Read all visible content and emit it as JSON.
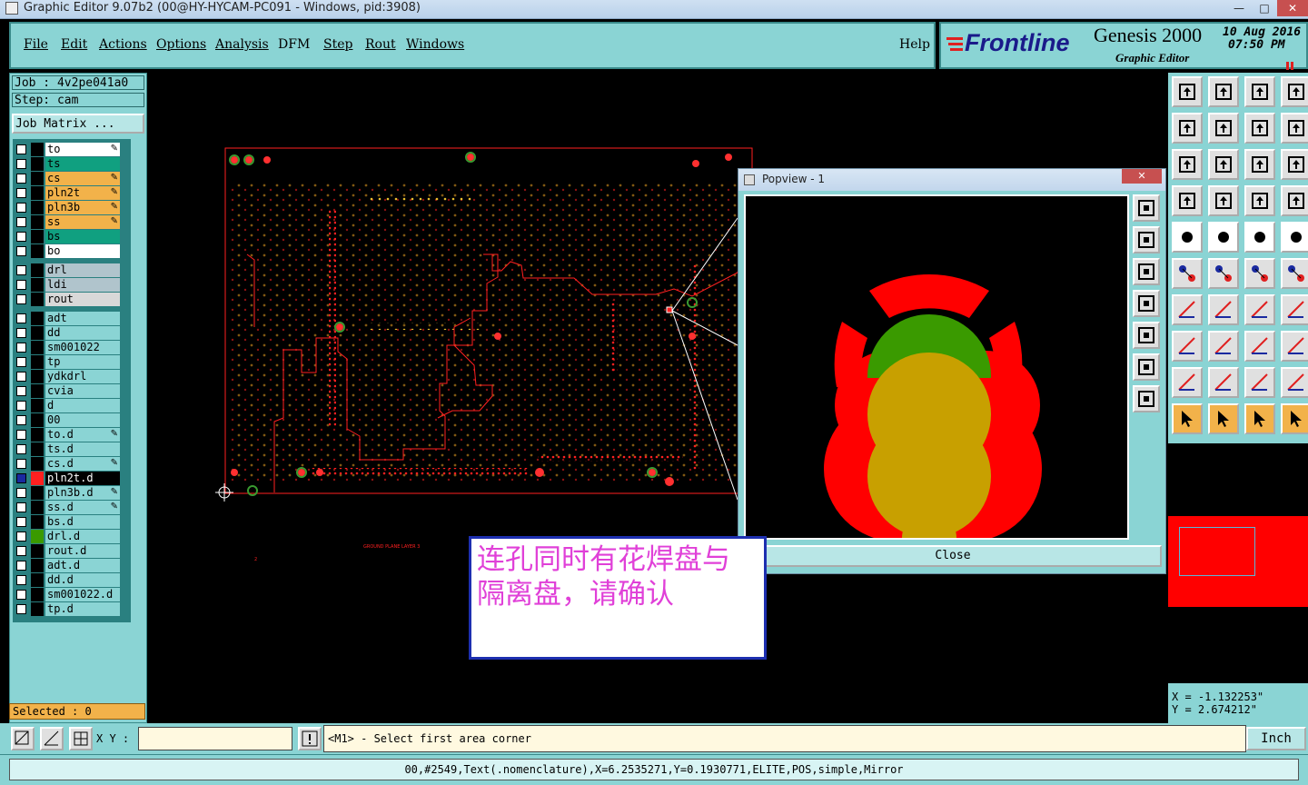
{
  "window": {
    "title": "Graphic Editor 9.07b2 (00@HY-HYCAM-PC091 - Windows, pid:3908)",
    "minimize": "—",
    "restore": "□",
    "close": "✕"
  },
  "menu": {
    "items": [
      "File",
      "Edit",
      "Actions",
      "Options",
      "Analysis",
      "DFM",
      "Step",
      "Rout",
      "Windows"
    ],
    "help": "Help"
  },
  "brand": {
    "logo": "Frontline",
    "product": "Genesis 2000",
    "subtitle": "Graphic Editor",
    "date": "10 Aug 2016",
    "time": "07:50 PM"
  },
  "job": {
    "job_label": "Job : 4v2pe041a0",
    "step_label": "Step: cam",
    "matrix_button": "Job Matrix ..."
  },
  "layers": [
    {
      "name": "to",
      "color": "#ffffff",
      "pen": true
    },
    {
      "name": "ts",
      "color": "#10a080",
      "pen": false
    },
    {
      "name": "cs",
      "color": "#f2b24a",
      "pen": true
    },
    {
      "name": "pln2t",
      "color": "#f2b24a",
      "pen": true
    },
    {
      "name": "pln3b",
      "color": "#f2b24a",
      "pen": true
    },
    {
      "name": "ss",
      "color": "#f2b24a",
      "pen": true
    },
    {
      "name": "bs",
      "color": "#10a080",
      "pen": false
    },
    {
      "name": "bo",
      "color": "#ffffff",
      "pen": false
    },
    {
      "name": "drl",
      "color": "#b0c4cc",
      "pen": false
    },
    {
      "name": "ldi",
      "color": "#b0c4cc",
      "pen": false
    },
    {
      "name": "rout",
      "color": "#d8d8d8",
      "pen": false
    },
    {
      "name": "adt",
      "color": "#8ad4d4",
      "pen": false
    },
    {
      "name": "dd",
      "color": "#8ad4d4",
      "pen": false
    },
    {
      "name": "sm001022",
      "color": "#8ad4d4",
      "pen": false
    },
    {
      "name": "tp",
      "color": "#8ad4d4",
      "pen": false
    },
    {
      "name": "ydkdrl",
      "color": "#8ad4d4",
      "pen": false
    },
    {
      "name": "cvia",
      "color": "#8ad4d4",
      "pen": false
    },
    {
      "name": "d",
      "color": "#8ad4d4",
      "pen": false
    },
    {
      "name": "00",
      "color": "#8ad4d4",
      "pen": false
    },
    {
      "name": "to.d",
      "color": "#8ad4d4",
      "pen": true
    },
    {
      "name": "ts.d",
      "color": "#8ad4d4",
      "pen": false
    },
    {
      "name": "cs.d",
      "color": "#8ad4d4",
      "pen": true
    },
    {
      "name": "pln2t.d",
      "color": "#8ad4d4",
      "pen": true
    },
    {
      "name": "pln3b.d",
      "color": "#8ad4d4",
      "pen": true
    },
    {
      "name": "ss.d",
      "color": "#8ad4d4",
      "pen": true
    },
    {
      "name": "bs.d",
      "color": "#8ad4d4",
      "pen": false
    },
    {
      "name": "drl.d",
      "color": "#8ad4d4",
      "pen": false
    },
    {
      "name": "rout.d",
      "color": "#8ad4d4",
      "pen": false
    },
    {
      "name": "adt.d",
      "color": "#8ad4d4",
      "pen": false
    },
    {
      "name": "dd.d",
      "color": "#8ad4d4",
      "pen": false
    },
    {
      "name": "sm001022.d",
      "color": "#8ad4d4",
      "pen": false
    },
    {
      "name": "tp.d",
      "color": "#8ad4d4",
      "pen": false
    }
  ],
  "selected_label": "Selected : 0",
  "canvas": {
    "board_text_1": "GROUND PLANE    LAYER 3",
    "board_text_2": "2"
  },
  "popview": {
    "title": "Popview - 1",
    "close_label": "Close"
  },
  "note": {
    "line1": "连孔同时有花焊盘与",
    "line2": "隔离盘，请确认"
  },
  "coords": {
    "x": "X = -1.132253\"",
    "y": "Y = 2.674212\""
  },
  "command": {
    "xy_label": "X Y :",
    "xy_value": "",
    "prompt": "<M1> - Select first area corner",
    "units": "Inch"
  },
  "status": {
    "text": "00,#2549,Text(.nomenclature),X=6.2535271,Y=0.1930771,ELITE,POS,simple,Mirror"
  },
  "colors": {
    "panel": "#8ad4d4",
    "accent_orange": "#f2b24a",
    "accent_green": "#10a080",
    "pad_red": "#ff0000",
    "pad_olive": "#c8a000",
    "pad_green": "#3a9a00",
    "note_text": "#e040d8"
  }
}
